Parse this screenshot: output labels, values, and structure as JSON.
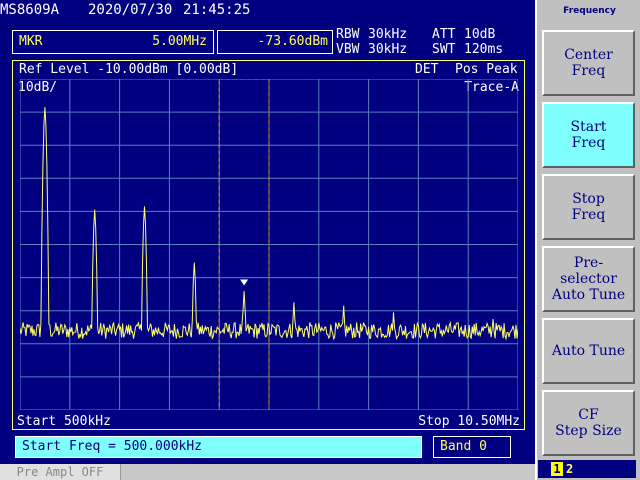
{
  "header": {
    "model": "MS8609A",
    "date": "2020/07/30",
    "time": "21:45:25"
  },
  "marker": {
    "label": "MKR",
    "freq": "5.00MHz",
    "level": "-73.60dBm"
  },
  "params": {
    "rbw_label": "RBW",
    "rbw_value": "30kHz",
    "vbw_label": "VBW",
    "vbw_value": "30kHz",
    "att_label": "ATT",
    "att_value": "10dB",
    "swt_label": "SWT",
    "swt_value": "120ms"
  },
  "display": {
    "ref_level": "Ref Level -10.00dBm [0.00dB]",
    "scale": "10dB/",
    "det_label": "DET",
    "det_value": "Pos Peak",
    "trace": "Trace-A",
    "start": "Start 500kHz",
    "stop": "Stop 10.50MHz"
  },
  "status": {
    "text": "Start Freq = 500.000kHz",
    "band": "Band 0"
  },
  "bottom": {
    "preamp": "Pre Ampl OFF"
  },
  "softkeys": {
    "title": "Frequency",
    "items": [
      {
        "label": "Center\nFreq"
      },
      {
        "label": "Start\nFreq"
      },
      {
        "label": "Stop\nFreq"
      },
      {
        "label": "Pre-\nselector\nAuto Tune"
      },
      {
        "label": "Auto Tune"
      },
      {
        "label": "CF\nStep Size"
      }
    ],
    "page_current": "1",
    "page_other": "2"
  },
  "colors": {
    "background": "#000080",
    "trace": "#ffff66",
    "grid": "#5a7fbf",
    "softkey_active": "#80ffff",
    "softkey": "#c0c0c0",
    "marker_box": "#ff8000"
  },
  "chart_data": {
    "type": "line",
    "x_range_hz": [
      500000,
      10500000
    ],
    "y_range_dbm": [
      -110,
      -10
    ],
    "peaks": [
      {
        "freq_hz": 1000000,
        "level_dbm": -18
      },
      {
        "freq_hz": 2000000,
        "level_dbm": -49
      },
      {
        "freq_hz": 3000000,
        "level_dbm": -48
      },
      {
        "freq_hz": 4000000,
        "level_dbm": -65
      },
      {
        "freq_hz": 5000000,
        "level_dbm": -73.6
      },
      {
        "freq_hz": 6000000,
        "level_dbm": -77
      },
      {
        "freq_hz": 7000000,
        "level_dbm": -78
      },
      {
        "freq_hz": 8000000,
        "level_dbm": -80
      },
      {
        "freq_hz": 10000000,
        "level_dbm": -82
      }
    ],
    "noise_floor_dbm": -86
  }
}
